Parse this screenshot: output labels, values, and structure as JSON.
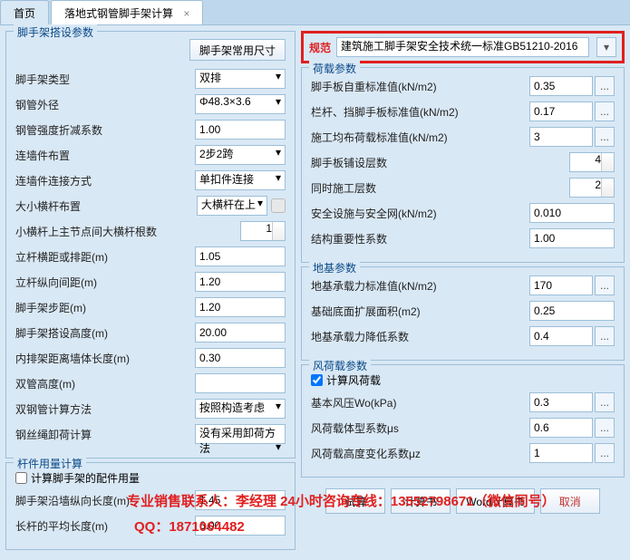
{
  "tabs": {
    "home": "首页",
    "active": "落地式钢管脚手架计算",
    "close": "×"
  },
  "left": {
    "p1": {
      "title": "脚手架搭设参数",
      "btn": "脚手架常用尺寸",
      "type_l": "脚手架类型",
      "type_v": "双排",
      "diam_l": "钢管外径",
      "diam_v": "Φ48.3×3.6",
      "str_l": "钢管强度折减系数",
      "str_v": "1.00",
      "wall_l": "连墙件布置",
      "wall_v": "2步2跨",
      "conn_l": "连墙件连接方式",
      "conn_v": "单扣件连接",
      "cross_l": "大小横杆布置",
      "cross_v": "大横杆在上",
      "roots_l": "小横杆上主节点间大横杆根数",
      "roots_v": "1",
      "span_l": "立杆横距或排距(m)",
      "span_v": "1.05",
      "vspc_l": "立杆纵向间距(m)",
      "vspc_v": "1.20",
      "step_l": "脚手架步距(m)",
      "step_v": "1.20",
      "height_l": "脚手架搭设高度(m)",
      "height_v": "20.00",
      "inner_l": "内排架距离墙体长度(m)",
      "inner_v": "0.30",
      "double_l": "双管高度(m)",
      "double_v": "",
      "dcalc_l": "双钢管计算方法",
      "dcalc_v": "按照构造考虑",
      "wire_l": "钢丝绳卸荷计算",
      "wire_v": "没有采用卸荷方法"
    },
    "p2": {
      "title": "杆件用量计算",
      "chk_l": "计算脚手架的配件用量",
      "chk_v": false,
      "edge_l": "脚手架沿墙纵向长度(m)",
      "edge_v": "1.45",
      "pole_l": "长杆的平均长度(m)",
      "pole_v": "6.00"
    }
  },
  "spec": {
    "label": "规范",
    "value": "建筑施工脚手架安全技术统一标准GB51210-2016"
  },
  "right": {
    "p1": {
      "title": "荷载参数",
      "self_l": "脚手板自重标准值(kN/m2)",
      "self_v": "0.35",
      "rail_l": "栏杆、挡脚手板标准值(kN/m2)",
      "rail_v": "0.17",
      "live_l": "施工均布荷载标准值(kN/m2)",
      "live_v": "3",
      "layers_l": "脚手板铺设层数",
      "layers_v": "4",
      "simul_l": "同时施工层数",
      "simul_v": "2",
      "safety_l": "安全设施与安全网(kN/m2)",
      "safety_v": "0.010",
      "imp_l": "结构重要性系数",
      "imp_v": "1.00"
    },
    "p2": {
      "title": "地基参数",
      "bear_l": "地基承载力标准值(kN/m2)",
      "bear_v": "170",
      "base_l": "基础底面扩展面积(m2)",
      "base_v": "0.25",
      "reduce_l": "地基承载力降低系数",
      "reduce_v": "0.4"
    },
    "p3": {
      "title": "风荷载参数",
      "chk_l": "计算风荷载",
      "chk_v": true,
      "wp_l": "基本风压Wo(kPa)",
      "wp_v": "0.3",
      "shape_l": "风荷载体型系数μs",
      "shape_v": "0.6",
      "ht_l": "风荷载高度变化系数μz",
      "ht_v": "1"
    }
  },
  "buttons": {
    "try": "试算",
    "calc": "计算书",
    "word": "Word计算书",
    "cancel": "取消"
  },
  "overlay": {
    "contact": "专业销售联系人：李经理   24小时咨询专线：13552798671（微信同号）",
    "qq": "QQ：1871064482"
  },
  "ellipsis": "...",
  "dd": "▾"
}
